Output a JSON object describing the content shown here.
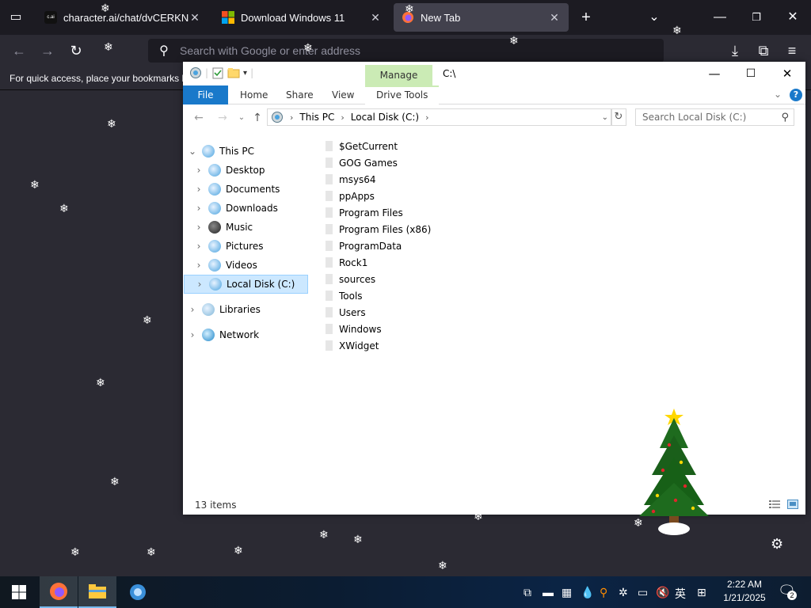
{
  "browser": {
    "tabs": [
      {
        "title": "character.ai/chat/dvCERKNNTa",
        "close": "✕",
        "active": false
      },
      {
        "title": "Download Windows 11",
        "close": "✕",
        "active": false
      },
      {
        "title": "New Tab",
        "close": "✕",
        "active": true
      }
    ],
    "url_placeholder": "Search with Google or enter address",
    "bookmarks_hint": "For quick access, place your bookmarks h"
  },
  "explorer": {
    "contextual_tab": "Manage",
    "title_path": "C:\\",
    "ribbon_tabs": [
      "File",
      "Home",
      "Share",
      "View",
      "Drive Tools"
    ],
    "breadcrumb": [
      "This PC",
      "Local Disk (C:)"
    ],
    "search_placeholder": "Search Local Disk (C:)",
    "nav_tree": [
      {
        "label": "This PC",
        "expanded": true
      },
      {
        "label": "Desktop"
      },
      {
        "label": "Documents"
      },
      {
        "label": "Downloads"
      },
      {
        "label": "Music"
      },
      {
        "label": "Pictures"
      },
      {
        "label": "Videos"
      },
      {
        "label": "Local Disk (C:)",
        "selected": true
      },
      {
        "label": "Libraries"
      },
      {
        "label": "Network"
      }
    ],
    "files": [
      "$GetCurrent",
      "GOG Games",
      "msys64",
      "ppApps",
      "Program Files",
      "Program Files (x86)",
      "ProgramData",
      "Rock1",
      "sources",
      "Tools",
      "Users",
      "Windows",
      "XWidget"
    ],
    "status_count": "13 items"
  },
  "taskbar": {
    "time": "2:22 AM",
    "date": "1/21/2025",
    "ime": "英",
    "notifications": "2"
  },
  "colors": {
    "browser_bg": "#2b2a33",
    "tab_active": "#42414d",
    "file_tab": "#1979ca",
    "manage_tab": "#cbebb5",
    "selection": "#cce8ff"
  }
}
